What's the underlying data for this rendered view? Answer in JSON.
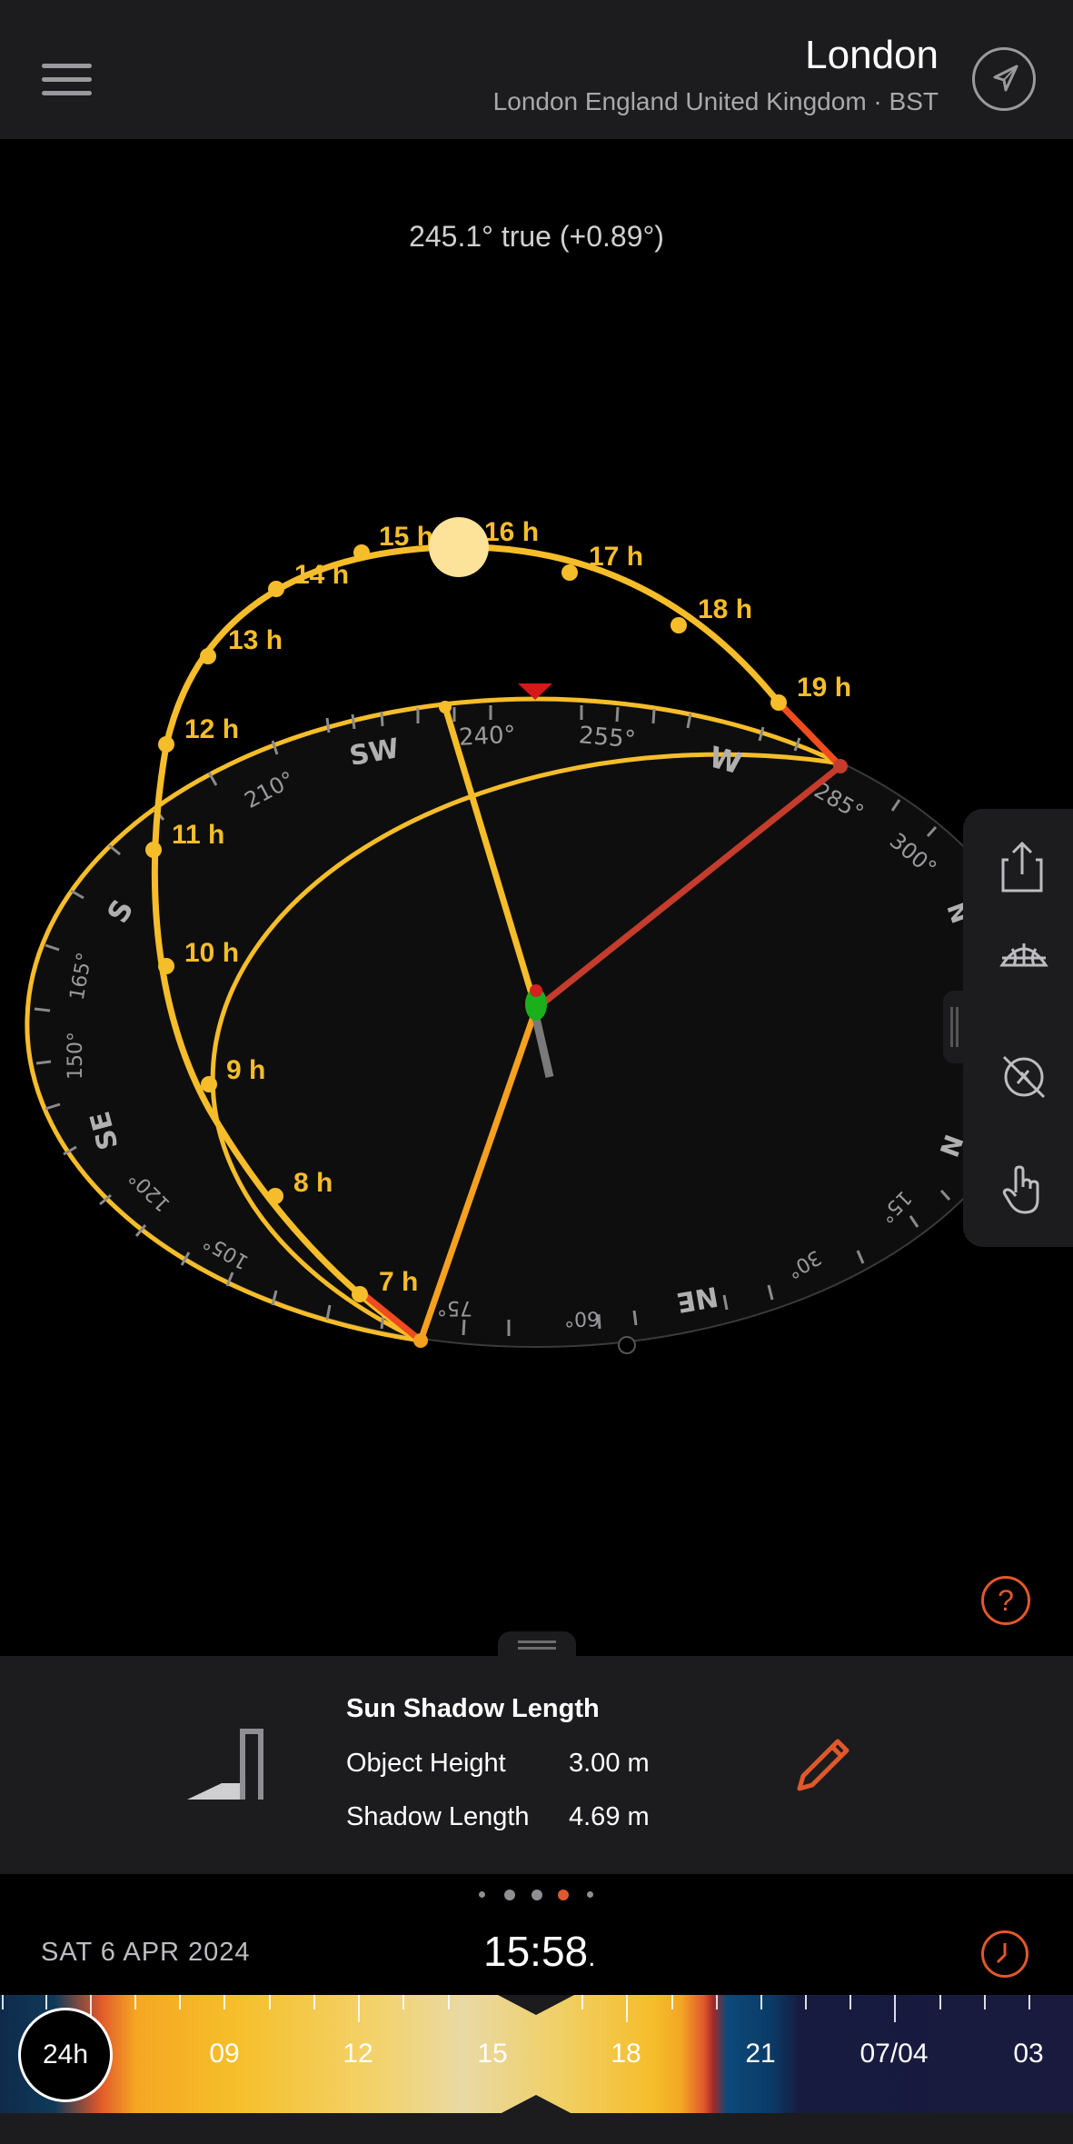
{
  "header": {
    "city": "London",
    "subtitle": "London England United Kingdom · BST"
  },
  "bearing": "245.1° true (+0.89°)",
  "compass": {
    "directions": [
      "SW",
      "W",
      "S",
      "SE",
      "NE",
      "N",
      "N"
    ],
    "degrees": [
      "240°",
      "255°",
      "210°",
      "285°",
      "300°",
      "165°",
      "150°",
      "120°",
      "105°",
      "75°",
      "60°",
      "30°",
      "15°"
    ],
    "hours": [
      "7 h",
      "8 h",
      "9 h",
      "10 h",
      "11 h",
      "12 h",
      "13 h",
      "14 h",
      "15 h",
      "16 h",
      "17 h",
      "18 h",
      "19 h"
    ]
  },
  "help": "?",
  "card": {
    "title": "Sun Shadow Length",
    "object_height_label": "Object Height",
    "object_height_value": "3.00 m",
    "shadow_length_label": "Shadow Length",
    "shadow_length_value": "4.69 m"
  },
  "date": "SAT 6 APR 2024",
  "time": "15:58",
  "time_suffix": ".",
  "timeline": {
    "btn": "24h",
    "labels": [
      "09",
      "12",
      "15",
      "18",
      "21",
      "07/04",
      "03"
    ]
  },
  "colors": {
    "accent": "#e0582b",
    "sun_path": "#f6bd2a",
    "shadow_line": "#c43c2c"
  }
}
